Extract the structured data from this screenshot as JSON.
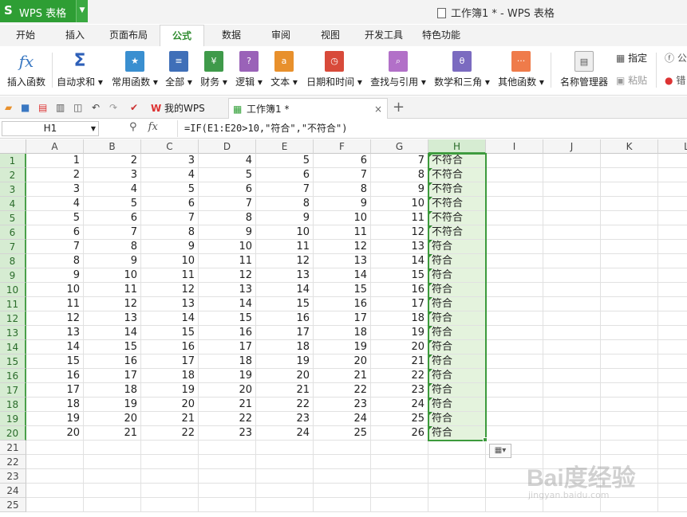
{
  "app": {
    "logo": "S",
    "name": "WPS 表格",
    "window_title": "工作簿1 * - WPS 表格"
  },
  "tabs": [
    {
      "label": "开始"
    },
    {
      "label": "插入"
    },
    {
      "label": "页面布局"
    },
    {
      "label": "公式",
      "active": true
    },
    {
      "label": "数据"
    },
    {
      "label": "审阅"
    },
    {
      "label": "视图"
    },
    {
      "label": "开发工具"
    },
    {
      "label": "特色功能"
    }
  ],
  "ribbon": {
    "insert_function": "插入函数",
    "autosum": "自动求和",
    "common_functions": "常用函数",
    "all": "全部",
    "finance": "财务",
    "logic": "逻辑",
    "text": "文本",
    "datetime": "日期和时间",
    "lookup": "查找与引用",
    "math": "数学和三角",
    "other": "其他函数",
    "name_manager": "名称管理器",
    "specify": "指定",
    "paste": "粘贴",
    "formula_cut": "公",
    "error_cut": "错"
  },
  "doctabs": {
    "mywps": "我的WPS",
    "workbook": "工作簿1 *",
    "close": "×",
    "add": "+"
  },
  "formula_bar": {
    "cell_ref": "H1",
    "fx": "fx",
    "formula": "=IF(E1:E20>10,\"符合\",\"不符合\")"
  },
  "grid": {
    "columns": [
      "A",
      "B",
      "C",
      "D",
      "E",
      "F",
      "G",
      "H",
      "I",
      "J",
      "K",
      "L"
    ],
    "selected_column": "H",
    "row_count": 25,
    "data_rows": [
      [
        1,
        2,
        3,
        4,
        5,
        6,
        7,
        "不符合"
      ],
      [
        2,
        3,
        4,
        5,
        6,
        7,
        8,
        "不符合"
      ],
      [
        3,
        4,
        5,
        6,
        7,
        8,
        9,
        "不符合"
      ],
      [
        4,
        5,
        6,
        7,
        8,
        9,
        10,
        "不符合"
      ],
      [
        5,
        6,
        7,
        8,
        9,
        10,
        11,
        "不符合"
      ],
      [
        6,
        7,
        8,
        9,
        10,
        11,
        12,
        "不符合"
      ],
      [
        7,
        8,
        9,
        10,
        11,
        12,
        13,
        "符合"
      ],
      [
        8,
        9,
        10,
        11,
        12,
        13,
        14,
        "符合"
      ],
      [
        9,
        10,
        11,
        12,
        13,
        14,
        15,
        "符合"
      ],
      [
        10,
        11,
        12,
        13,
        14,
        15,
        16,
        "符合"
      ],
      [
        11,
        12,
        13,
        14,
        15,
        16,
        17,
        "符合"
      ],
      [
        12,
        13,
        14,
        15,
        16,
        17,
        18,
        "符合"
      ],
      [
        13,
        14,
        15,
        16,
        17,
        18,
        19,
        "符合"
      ],
      [
        14,
        15,
        16,
        17,
        18,
        19,
        20,
        "符合"
      ],
      [
        15,
        16,
        17,
        18,
        19,
        20,
        21,
        "符合"
      ],
      [
        16,
        17,
        18,
        19,
        20,
        21,
        22,
        "符合"
      ],
      [
        17,
        18,
        19,
        20,
        21,
        22,
        23,
        "符合"
      ],
      [
        18,
        19,
        20,
        21,
        22,
        23,
        24,
        "符合"
      ],
      [
        19,
        20,
        21,
        22,
        23,
        24,
        25,
        "符合"
      ],
      [
        20,
        21,
        22,
        23,
        24,
        25,
        26,
        "符合"
      ]
    ]
  },
  "watermark": {
    "brand": "Bai度经验",
    "url": "jingyan.baidu.com"
  },
  "colors": {
    "accent": "#2e9e34",
    "selection": "#3c9a3c",
    "selected_fill": "#e4f3dd"
  }
}
